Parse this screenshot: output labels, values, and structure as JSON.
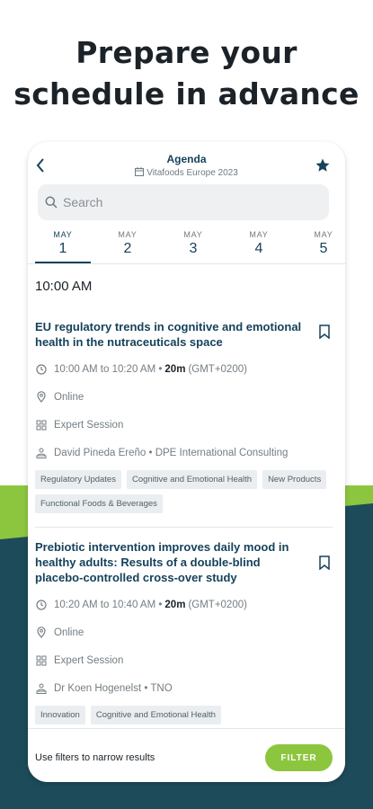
{
  "headline": {
    "line1": "Prepare your",
    "line2": "schedule in advance"
  },
  "header": {
    "title": "Agenda",
    "subtitle": "Vitafoods Europe 2023"
  },
  "search": {
    "placeholder": "Search"
  },
  "days": [
    {
      "month": "MAY",
      "day": "1",
      "selected": true
    },
    {
      "month": "MAY",
      "day": "2",
      "selected": false
    },
    {
      "month": "MAY",
      "day": "3",
      "selected": false
    },
    {
      "month": "MAY",
      "day": "4",
      "selected": false
    },
    {
      "month": "MAY",
      "day": "5",
      "selected": false
    }
  ],
  "time_heading": "10:00 AM",
  "sessions": [
    {
      "title": "EU regulatory trends in cognitive and emotional health in the nutraceuticals space",
      "time_range": "10:00 AM to 10:20 AM",
      "duration": "20m",
      "timezone": "(GMT+0200)",
      "location": "Online",
      "type": "Expert Session",
      "speaker": "David Pineda Ereño • DPE International Consulting",
      "tags": [
        "Regulatory Updates",
        "Cognitive and Emotional Health",
        "New Products",
        "Functional Foods & Beverages"
      ]
    },
    {
      "title": "Prebiotic intervention improves daily mood in healthy adults: Results of a double-blind placebo-controlled cross-over study",
      "time_range": "10:20 AM to 10:40 AM",
      "duration": "20m",
      "timezone": "(GMT+0200)",
      "location": "Online",
      "type": "Expert Session",
      "speaker": "Dr Koen Hogenelst • TNO",
      "tags": [
        "Innovation",
        "Cognitive and Emotional Health"
      ]
    }
  ],
  "footer": {
    "hint": "Use filters to narrow results",
    "filter_label": "FILTER"
  },
  "colors": {
    "primary": "#16425b",
    "accent": "#8cc63f",
    "band": "#1d4b5a"
  },
  "icons": [
    "back-arrow-icon",
    "calendar-icon",
    "star-icon",
    "search-icon",
    "clock-icon",
    "location-pin-icon",
    "session-type-icon",
    "speaker-icon",
    "bookmark-icon"
  ]
}
